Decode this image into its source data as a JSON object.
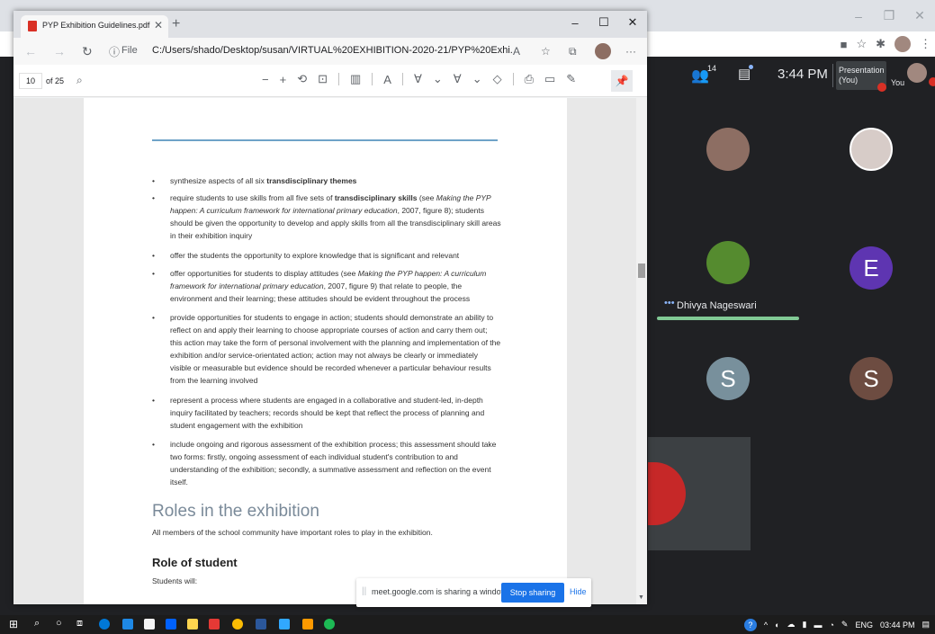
{
  "background_window": {
    "meet": {
      "participants_count": "14",
      "time": "3:44 PM",
      "presentation_label": "Presentation (You)",
      "you_label": "You",
      "speaker_name": "Dhivya Nageswari",
      "letter_avatars": [
        "E",
        "S",
        "S"
      ]
    }
  },
  "edge": {
    "tab_title": "PYP Exhibition Guidelines.pdf",
    "scheme": "File",
    "url": "C:/Users/shado/Desktop/susan/VIRTUAL%20EXHIBITION-2020-21/PYP%20Exhi...",
    "page_number": "10",
    "page_total": "of 25"
  },
  "document": {
    "bullets": [
      {
        "pre": "synthesize aspects of all six ",
        "bold": "transdisciplinary themes",
        "post": ""
      },
      {
        "pre": "require students to use skills from all five sets of ",
        "bold": "transdisciplinary skills",
        "mid": " (see ",
        "italic": "Making the PYP happen: A curriculum framework for international primary education",
        "post": ", 2007, figure 8); students should be given the opportunity to develop and apply skills from all the transdisciplinary skill areas in their exhibition inquiry"
      },
      {
        "pre": "offer the students the opportunity to explore knowledge that is significant and relevant",
        "bold": "",
        "post": ""
      },
      {
        "pre": "offer opportunities for students to display attitudes (see ",
        "italic": "Making the PYP happen: A curriculum framework for international primary education",
        "post": ", 2007, figure 9) that relate to people, the environment and their learning; these attitudes should be evident throughout the process"
      },
      {
        "pre": "provide opportunities for students to engage in action; students should demonstrate an ability to reflect on and apply their learning to choose appropriate courses of action and carry them out; this action may take the form of personal involvement with the planning and implementation of the exhibition and/or service-orientated action; action may not always be clearly or immediately visible or measurable but evidence should be recorded whenever a particular behaviour results from the learning involved",
        "bold": "",
        "post": ""
      },
      {
        "pre": "represent a process where students are engaged in a collaborative and student-led, in-depth inquiry facilitated by teachers; records should be kept that reflect the process of planning and student engagement with the exhibition",
        "bold": "",
        "post": ""
      },
      {
        "pre": "include ongoing and rigorous assessment of the exhibition process; this assessment should take two forms: firstly, ongoing assessment of each individual student's contribution to and understanding of the exhibition; secondly, a summative assessment and reflection on the event itself.",
        "bold": "",
        "post": ""
      }
    ],
    "section_heading": "Roles in the exhibition",
    "section_intro": "All members of the school community have important roles to play in the exhibition.",
    "subheading": "Role of student",
    "students_will": "Students will:"
  },
  "share_bar": {
    "text": "meet.google.com is sharing a window.",
    "stop_label": "Stop sharing",
    "hide_label": "Hide"
  },
  "taskbar": {
    "language": "ENG",
    "clock": "03:44 PM"
  }
}
